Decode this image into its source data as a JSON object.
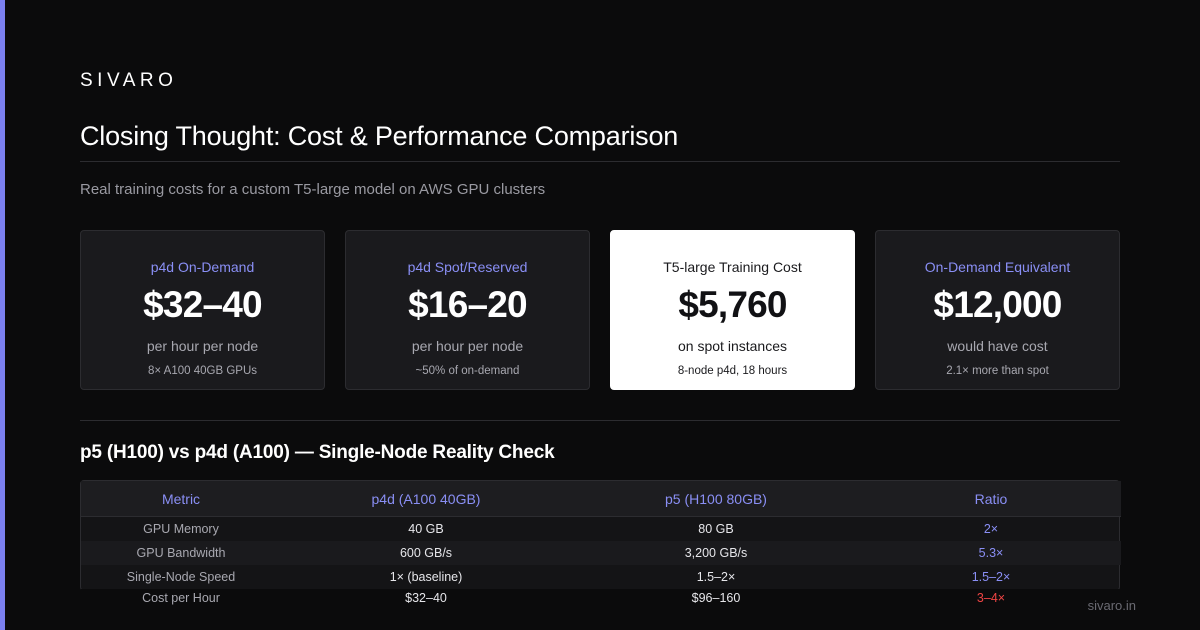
{
  "brand": "SIVARO",
  "title": "Closing Thought: Cost & Performance Comparison",
  "subtitle": "Real training costs for a custom T5-large model on AWS GPU clusters",
  "cards": [
    {
      "label": "p4d On-Demand",
      "value": "$32–40",
      "desc": "per hour per node",
      "note": "8× A100 40GB GPUs"
    },
    {
      "label": "p4d Spot/Reserved",
      "value": "$16–20",
      "desc": "per hour per node",
      "note": "~50% of on-demand"
    },
    {
      "label": "T5-large Training Cost",
      "value": "$5,760",
      "desc": "on spot instances",
      "note": "8-node p4d, 18 hours"
    },
    {
      "label": "On-Demand Equivalent",
      "value": "$12,000",
      "desc": "would have cost",
      "note": "2.1× more than spot"
    }
  ],
  "section_title": "p5 (H100) vs p4d (A100) — Single-Node Reality Check",
  "table": {
    "headers": [
      "Metric",
      "p4d (A100 40GB)",
      "p5 (H100 80GB)",
      "Ratio"
    ],
    "rows": [
      [
        "GPU Memory",
        "40 GB",
        "80 GB",
        "2×"
      ],
      [
        "GPU Bandwidth",
        "600 GB/s",
        "3,200 GB/s",
        "5.3×"
      ],
      [
        "Single-Node Speed",
        "1× (baseline)",
        "1.5–2×",
        "1.5–2×"
      ],
      [
        "Cost per Hour",
        "$32–40",
        "$96–160",
        "3–4×"
      ]
    ]
  },
  "footer": "sivaro.in",
  "colors": {
    "accent": "#7b80f0",
    "label": "#8a8ff5",
    "warning": "#ef4444",
    "background": "#0b0b0c"
  }
}
